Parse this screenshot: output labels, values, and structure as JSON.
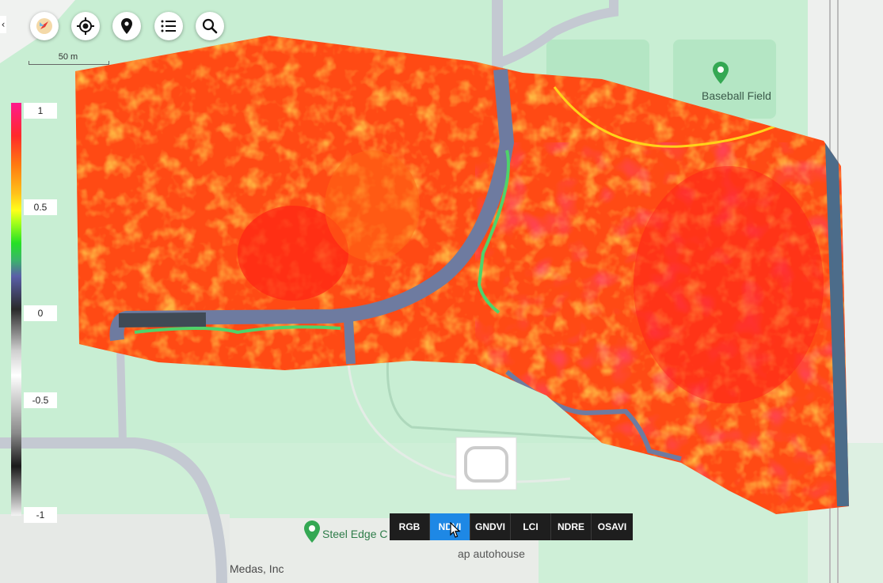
{
  "toolbar": {
    "buttons": [
      {
        "icon": "compass-icon"
      },
      {
        "icon": "locate-icon"
      },
      {
        "icon": "map-pin-icon"
      },
      {
        "icon": "list-icon"
      },
      {
        "icon": "search-icon"
      }
    ],
    "collapse_glyph": "‹"
  },
  "scale": {
    "label": "50 m"
  },
  "legend": {
    "ticks": [
      "1",
      "0.5",
      "0",
      "-0.5",
      "-1"
    ]
  },
  "places": {
    "baseball_field": "Baseball Field",
    "steel_edge": "Steel Edge C",
    "medas": "Medas, Inc",
    "autohouse": "ap autohouse"
  },
  "index_tabs": [
    "RGB",
    "NDVI",
    "GNDVI",
    "LCI",
    "NDRE",
    "OSAVI"
  ],
  "active_tab": "NDVI",
  "colors": {
    "map_green": "#c8eed3",
    "road": "#c4c9d2",
    "accent": "#1e88e5",
    "poi_green": "#34a853"
  }
}
